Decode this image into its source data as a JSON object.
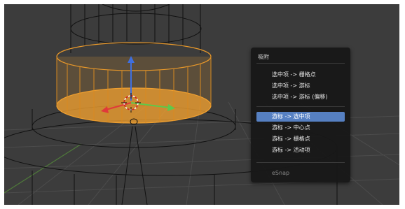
{
  "viewport": {
    "background": "#3c3c3c",
    "selection_color": "#f0a030",
    "axis_colors": {
      "x": "#e03a3a",
      "y": "#5fc84a",
      "z": "#3f6fe0"
    }
  },
  "snap_menu": {
    "title": "吸附",
    "items": [
      {
        "label": "选中项 -> 栅格点",
        "active": false
      },
      {
        "label": "选中项 -> 游标",
        "active": false
      },
      {
        "label": "选中项 -> 游标 (偏移)",
        "active": false
      },
      {
        "label": "游标 -> 选中项",
        "active": true
      },
      {
        "label": "游标 -> 中心点",
        "active": false
      },
      {
        "label": "游标 -> 栅格点",
        "active": false
      },
      {
        "label": "游标 -> 活动项",
        "active": false
      }
    ],
    "footer": "eSnap",
    "highlight_color": "#5680c2"
  }
}
